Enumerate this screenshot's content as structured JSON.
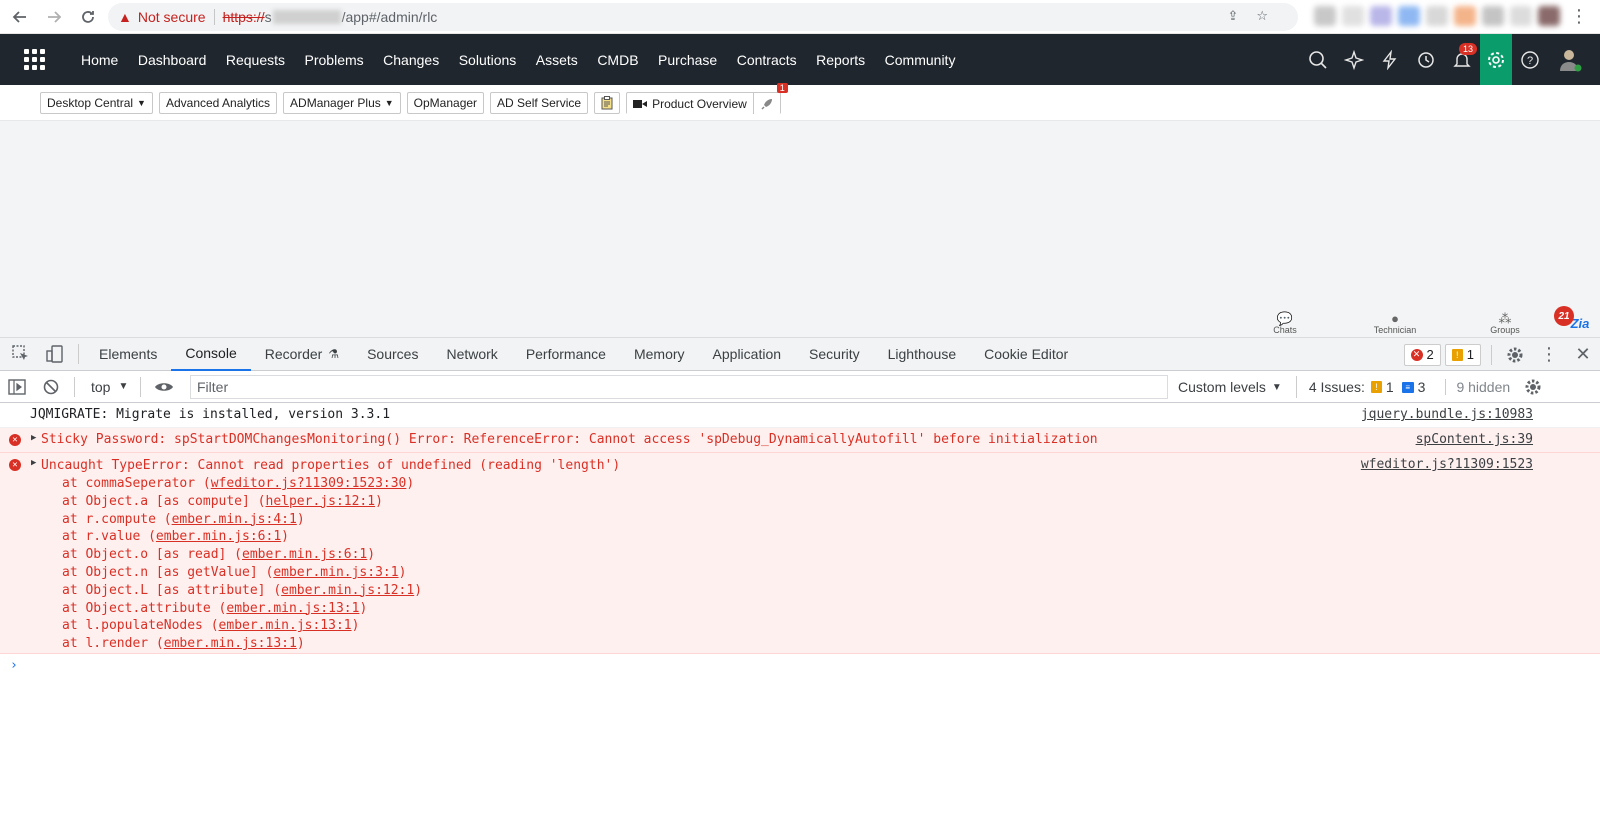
{
  "browser": {
    "not_secure": "Not secure",
    "url_proto": "https://",
    "url_hidden_prefix": "s",
    "url_path": "/app#/admin/rlc"
  },
  "header": {
    "nav": [
      "Home",
      "Dashboard",
      "Requests",
      "Problems",
      "Changes",
      "Solutions",
      "Assets",
      "CMDB",
      "Purchase",
      "Contracts",
      "Reports",
      "Community"
    ],
    "notif_count": "13"
  },
  "toolbar": {
    "desktop_central": "Desktop Central",
    "advanced_analytics": "Advanced Analytics",
    "admanager_plus": "ADManager Plus",
    "opmanager": "OpManager",
    "ad_self_service": "AD Self Service",
    "product_overview": "Product Overview",
    "rocket_badge": "1"
  },
  "chatbar": {
    "chats": "Chats",
    "technician": "Technician",
    "groups": "Groups",
    "zia_badge": "21",
    "zia_label": "Zia"
  },
  "devtools": {
    "tabs": [
      "Elements",
      "Console",
      "Recorder",
      "Sources",
      "Network",
      "Performance",
      "Memory",
      "Application",
      "Security",
      "Lighthouse",
      "Cookie Editor"
    ],
    "error_count": "2",
    "warning_count": "1",
    "context": "top",
    "filter_placeholder": "Filter",
    "levels": "Custom levels",
    "issues_label": "4 Issues:",
    "issues_warn": "1",
    "issues_info": "3",
    "hidden": "9 hidden"
  },
  "console": {
    "log1": {
      "text": "JQMIGRATE: Migrate is installed, version 3.3.1",
      "src": "jquery.bundle.js:10983"
    },
    "err1": {
      "text": "Sticky Password: spStartDOMChangesMonitoring() Error: ReferenceError: Cannot access 'spDebug_DynamicallyAutofill' before initialization",
      "src": "spContent.js:39"
    },
    "err2": {
      "text": "Uncaught TypeError: Cannot read properties of undefined (reading 'length')",
      "src": "wfeditor.js?11309:1523",
      "stack": [
        {
          "pre": "at commaSeperator (",
          "link": "wfeditor.js?11309:1523:30",
          "post": ")"
        },
        {
          "pre": "at Object.a [as compute] (",
          "link": "helper.js:12:1",
          "post": ")"
        },
        {
          "pre": "at r.compute (",
          "link": "ember.min.js:4:1",
          "post": ")"
        },
        {
          "pre": "at r.value (",
          "link": "ember.min.js:6:1",
          "post": ")"
        },
        {
          "pre": "at Object.o [as read] (",
          "link": "ember.min.js:6:1",
          "post": ")"
        },
        {
          "pre": "at Object.n [as getValue] (",
          "link": "ember.min.js:3:1",
          "post": ")"
        },
        {
          "pre": "at Object.L [as attribute] (",
          "link": "ember.min.js:12:1",
          "post": ")"
        },
        {
          "pre": "at Object.attribute (",
          "link": "ember.min.js:13:1",
          "post": ")"
        },
        {
          "pre": "at l.populateNodes (",
          "link": "ember.min.js:13:1",
          "post": ")"
        },
        {
          "pre": "at l.render (",
          "link": "ember.min.js:13:1",
          "post": ")"
        }
      ]
    }
  }
}
